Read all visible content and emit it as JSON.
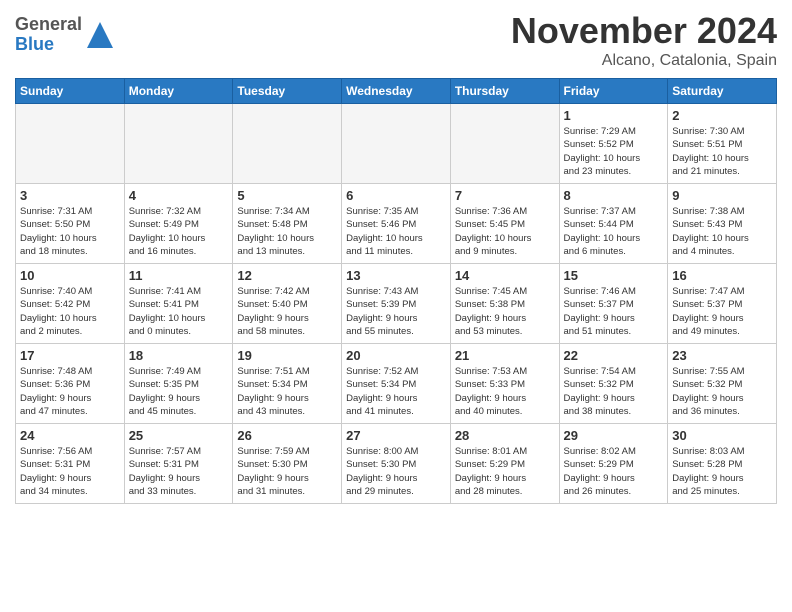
{
  "header": {
    "logo_general": "General",
    "logo_blue": "Blue",
    "month": "November 2024",
    "location": "Alcano, Catalonia, Spain"
  },
  "weekdays": [
    "Sunday",
    "Monday",
    "Tuesday",
    "Wednesday",
    "Thursday",
    "Friday",
    "Saturday"
  ],
  "weeks": [
    [
      {
        "day": "",
        "info": ""
      },
      {
        "day": "",
        "info": ""
      },
      {
        "day": "",
        "info": ""
      },
      {
        "day": "",
        "info": ""
      },
      {
        "day": "",
        "info": ""
      },
      {
        "day": "1",
        "info": "Sunrise: 7:29 AM\nSunset: 5:52 PM\nDaylight: 10 hours\nand 23 minutes."
      },
      {
        "day": "2",
        "info": "Sunrise: 7:30 AM\nSunset: 5:51 PM\nDaylight: 10 hours\nand 21 minutes."
      }
    ],
    [
      {
        "day": "3",
        "info": "Sunrise: 7:31 AM\nSunset: 5:50 PM\nDaylight: 10 hours\nand 18 minutes."
      },
      {
        "day": "4",
        "info": "Sunrise: 7:32 AM\nSunset: 5:49 PM\nDaylight: 10 hours\nand 16 minutes."
      },
      {
        "day": "5",
        "info": "Sunrise: 7:34 AM\nSunset: 5:48 PM\nDaylight: 10 hours\nand 13 minutes."
      },
      {
        "day": "6",
        "info": "Sunrise: 7:35 AM\nSunset: 5:46 PM\nDaylight: 10 hours\nand 11 minutes."
      },
      {
        "day": "7",
        "info": "Sunrise: 7:36 AM\nSunset: 5:45 PM\nDaylight: 10 hours\nand 9 minutes."
      },
      {
        "day": "8",
        "info": "Sunrise: 7:37 AM\nSunset: 5:44 PM\nDaylight: 10 hours\nand 6 minutes."
      },
      {
        "day": "9",
        "info": "Sunrise: 7:38 AM\nSunset: 5:43 PM\nDaylight: 10 hours\nand 4 minutes."
      }
    ],
    [
      {
        "day": "10",
        "info": "Sunrise: 7:40 AM\nSunset: 5:42 PM\nDaylight: 10 hours\nand 2 minutes."
      },
      {
        "day": "11",
        "info": "Sunrise: 7:41 AM\nSunset: 5:41 PM\nDaylight: 10 hours\nand 0 minutes."
      },
      {
        "day": "12",
        "info": "Sunrise: 7:42 AM\nSunset: 5:40 PM\nDaylight: 9 hours\nand 58 minutes."
      },
      {
        "day": "13",
        "info": "Sunrise: 7:43 AM\nSunset: 5:39 PM\nDaylight: 9 hours\nand 55 minutes."
      },
      {
        "day": "14",
        "info": "Sunrise: 7:45 AM\nSunset: 5:38 PM\nDaylight: 9 hours\nand 53 minutes."
      },
      {
        "day": "15",
        "info": "Sunrise: 7:46 AM\nSunset: 5:37 PM\nDaylight: 9 hours\nand 51 minutes."
      },
      {
        "day": "16",
        "info": "Sunrise: 7:47 AM\nSunset: 5:37 PM\nDaylight: 9 hours\nand 49 minutes."
      }
    ],
    [
      {
        "day": "17",
        "info": "Sunrise: 7:48 AM\nSunset: 5:36 PM\nDaylight: 9 hours\nand 47 minutes."
      },
      {
        "day": "18",
        "info": "Sunrise: 7:49 AM\nSunset: 5:35 PM\nDaylight: 9 hours\nand 45 minutes."
      },
      {
        "day": "19",
        "info": "Sunrise: 7:51 AM\nSunset: 5:34 PM\nDaylight: 9 hours\nand 43 minutes."
      },
      {
        "day": "20",
        "info": "Sunrise: 7:52 AM\nSunset: 5:34 PM\nDaylight: 9 hours\nand 41 minutes."
      },
      {
        "day": "21",
        "info": "Sunrise: 7:53 AM\nSunset: 5:33 PM\nDaylight: 9 hours\nand 40 minutes."
      },
      {
        "day": "22",
        "info": "Sunrise: 7:54 AM\nSunset: 5:32 PM\nDaylight: 9 hours\nand 38 minutes."
      },
      {
        "day": "23",
        "info": "Sunrise: 7:55 AM\nSunset: 5:32 PM\nDaylight: 9 hours\nand 36 minutes."
      }
    ],
    [
      {
        "day": "24",
        "info": "Sunrise: 7:56 AM\nSunset: 5:31 PM\nDaylight: 9 hours\nand 34 minutes."
      },
      {
        "day": "25",
        "info": "Sunrise: 7:57 AM\nSunset: 5:31 PM\nDaylight: 9 hours\nand 33 minutes."
      },
      {
        "day": "26",
        "info": "Sunrise: 7:59 AM\nSunset: 5:30 PM\nDaylight: 9 hours\nand 31 minutes."
      },
      {
        "day": "27",
        "info": "Sunrise: 8:00 AM\nSunset: 5:30 PM\nDaylight: 9 hours\nand 29 minutes."
      },
      {
        "day": "28",
        "info": "Sunrise: 8:01 AM\nSunset: 5:29 PM\nDaylight: 9 hours\nand 28 minutes."
      },
      {
        "day": "29",
        "info": "Sunrise: 8:02 AM\nSunset: 5:29 PM\nDaylight: 9 hours\nand 26 minutes."
      },
      {
        "day": "30",
        "info": "Sunrise: 8:03 AM\nSunset: 5:28 PM\nDaylight: 9 hours\nand 25 minutes."
      }
    ]
  ]
}
